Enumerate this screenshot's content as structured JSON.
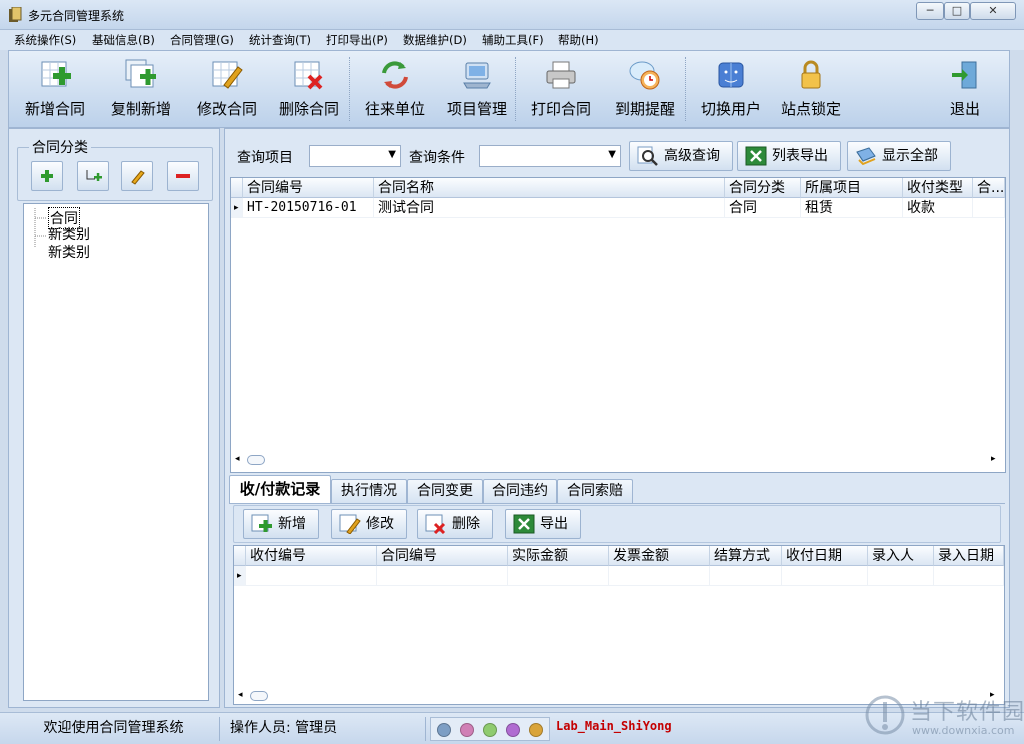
{
  "window": {
    "title": "多元合同管理系统",
    "min": "─",
    "max": "□",
    "close": "✕"
  },
  "menu": [
    "系统操作(S)",
    "基础信息(B)",
    "合同管理(G)",
    "统计查询(T)",
    "打印导出(P)",
    "数据维护(D)",
    "辅助工具(F)",
    "帮助(H)"
  ],
  "toolbar": {
    "new_contract": "新增合同",
    "copy_new": "复制新增",
    "edit_contract": "修改合同",
    "delete_contract": "删除合同",
    "partners": "往来单位",
    "projects": "项目管理",
    "print_contract": "打印合同",
    "expiry_reminder": "到期提醒",
    "switch_user": "切换用户",
    "lock_station": "站点锁定",
    "exit": "退出"
  },
  "left": {
    "group_title": "合同分类",
    "tree": [
      "合同",
      "新类别",
      "新类别"
    ]
  },
  "query": {
    "item_label": "查询项目",
    "item_value": "",
    "cond_label": "查询条件",
    "cond_value": "",
    "advanced": "高级查询",
    "export_list": "列表导出",
    "show_all": "显示全部"
  },
  "contracts": {
    "columns": [
      "合同编号",
      "合同名称",
      "合同分类",
      "所属项目",
      "收付类型",
      "合..."
    ],
    "rows": [
      [
        "HT-20150716-01",
        "测试合同",
        "合同",
        "租赁",
        "收款",
        ""
      ]
    ]
  },
  "tabs": [
    "收/付款记录",
    "执行情况",
    "合同变更",
    "合同违约",
    "合同索赔"
  ],
  "sub": {
    "add": "新增",
    "edit": "修改",
    "delete": "删除",
    "export": "导出"
  },
  "payments": {
    "columns": [
      "收付编号",
      "合同编号",
      "实际金额",
      "发票金额",
      "结算方式",
      "收付日期",
      "录入人",
      "录入日期"
    ]
  },
  "status": {
    "welcome": "欢迎使用合同管理系统",
    "operator": "操作人员: 管理员",
    "lab": "Lab_Main_ShiYong"
  },
  "colors": {
    "dots": [
      "#7d9ec4",
      "#d07fb5",
      "#8fcb6f",
      "#b06cd1",
      "#d9a43a"
    ],
    "lab_text": "#c40000"
  },
  "watermark": {
    "brand": "当下软件园",
    "url": "www.downxia.com"
  }
}
